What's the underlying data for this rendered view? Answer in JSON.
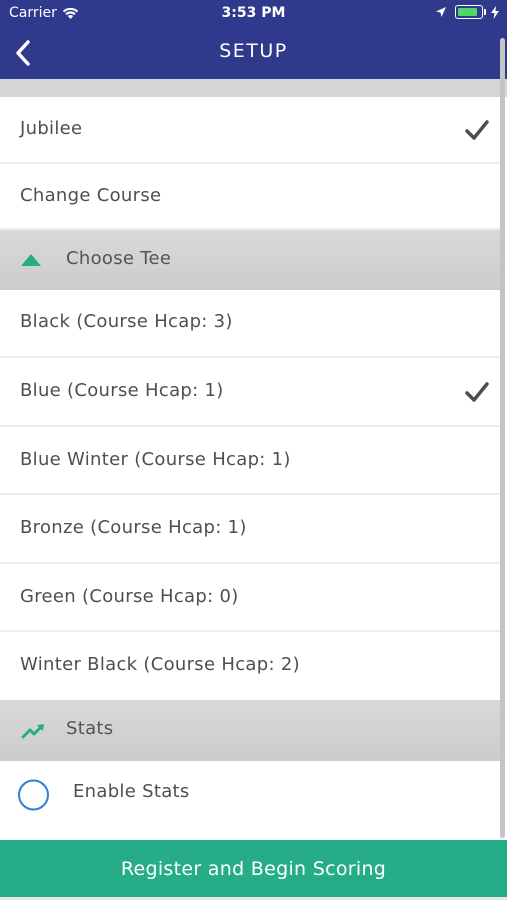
{
  "status_bar": {
    "carrier": "Carrier",
    "time": "3:53 PM"
  },
  "nav": {
    "title": "SETUP"
  },
  "course": {
    "name": "Jubilee",
    "change_label": "Change Course"
  },
  "tee_section": {
    "title": "Choose Tee",
    "items": [
      {
        "label": "Black (Course Hcap: 3)",
        "selected": false
      },
      {
        "label": "Blue (Course Hcap: 1)",
        "selected": true
      },
      {
        "label": "Blue Winter (Course Hcap: 1)",
        "selected": false
      },
      {
        "label": "Bronze (Course Hcap: 1)",
        "selected": false
      },
      {
        "label": "Green (Course Hcap: 0)",
        "selected": false
      },
      {
        "label": "Winter Black (Course Hcap: 2)",
        "selected": false
      }
    ]
  },
  "stats_section": {
    "title": "Stats",
    "enable_label": "Enable Stats"
  },
  "cta": {
    "label": "Register and Begin Scoring"
  },
  "colors": {
    "nav_bg": "#2f3a8c",
    "accent": "#26ad88",
    "radio": "#2f7fd6"
  },
  "icons": [
    "back-chevron-icon",
    "checkmark-icon",
    "collapse-arrow-icon",
    "trend-up-icon",
    "wifi-icon",
    "location-icon",
    "battery-icon",
    "charging-bolt-icon"
  ]
}
